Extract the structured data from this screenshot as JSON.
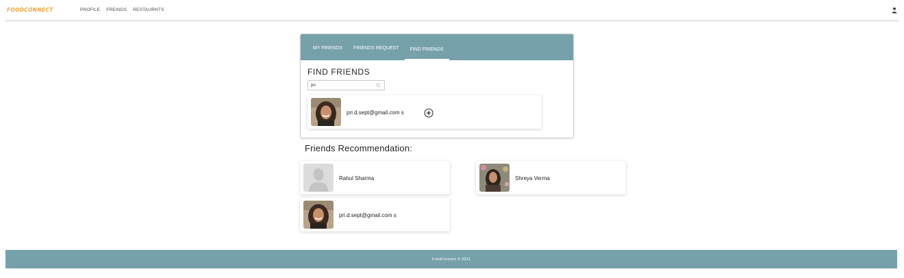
{
  "app": {
    "brand": "FOODCONNECT",
    "nav": [
      "PROFILE",
      "FREINDS",
      "RESTAURNTS"
    ],
    "user_icon": "user-icon"
  },
  "find_friends": {
    "tabs": [
      {
        "label": "MY FRIENDS",
        "active": false
      },
      {
        "label": "FRIENDS REQUEST",
        "active": false
      },
      {
        "label": "FIND FRIENDS",
        "active": true
      }
    ],
    "heading": "FIND FRIENDS",
    "search_value": "pri",
    "search_icon": "search-icon",
    "results": [
      {
        "name": "pri.d.sept@gmail.com s",
        "add_icon": "add-circle-icon"
      }
    ]
  },
  "recommendations": {
    "heading": "Friends Recommendation:",
    "items": [
      {
        "name": "Rahul Sharma",
        "avatar": "placeholder-avatar"
      },
      {
        "name": "Shreya Verma",
        "avatar": "photo-avatar"
      },
      {
        "name": "pri.d.sept@gmail.com s",
        "avatar": "photo-avatar"
      }
    ]
  },
  "footer": {
    "text": "FoodConnect © 2021"
  },
  "colors": {
    "accent": "#76a1aa",
    "brand": "#f0a43a"
  }
}
